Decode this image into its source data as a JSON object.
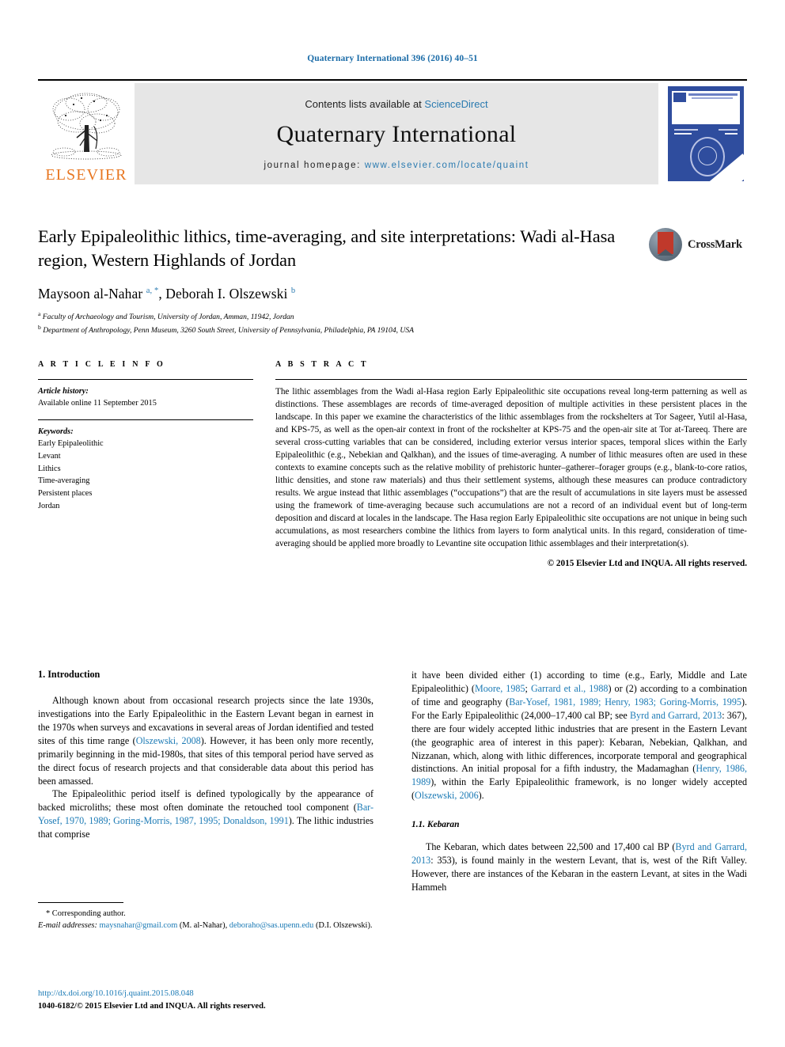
{
  "running_head": "Quaternary International 396 (2016) 40–51",
  "masthead": {
    "contents_prefix": "Contents lists available at ",
    "contents_link": "ScienceDirect",
    "journal_name": "Quaternary International",
    "homepage_label": "journal homepage:",
    "homepage_url": "www.elsevier.com/locate/quaint",
    "publisher": "ELSEVIER"
  },
  "article": {
    "title": "Early Epipaleolithic lithics, time-averaging, and site interpretations: Wadi al-Hasa region, Western Highlands of Jordan",
    "authors_html": "Maysoon al-Nahar <sup>a, *</sup>, Deborah I. Olszewski <sup>b</sup>",
    "affiliation_a": "Faculty of Archaeology and Tourism, University of Jordan, Amman, 11942, Jordan",
    "affiliation_b": "Department of Anthropology, Penn Museum, 3260 South Street, University of Pennsylvania, Philadelphia, PA 19104, USA",
    "crossmark_label": "CrossMark"
  },
  "info": {
    "heading": "A R T I C L E   I N F O",
    "history_label": "Article history:",
    "history_value": "Available online 11 September 2015",
    "keywords_label": "Keywords:",
    "keywords": [
      "Early Epipaleolithic",
      "Levant",
      "Lithics",
      "Time-averaging",
      "Persistent places",
      "Jordan"
    ]
  },
  "abstract": {
    "heading": "A B S T R A C T",
    "text": "The lithic assemblages from the Wadi al-Hasa region Early Epipaleolithic site occupations reveal long-term patterning as well as distinctions. These assemblages are records of time-averaged deposition of multiple activities in these persistent places in the landscape. In this paper we examine the characteristics of the lithic assemblages from the rockshelters at Tor Sageer, Yutil al-Hasa, and KPS-75, as well as the open-air context in front of the rockshelter at KPS-75 and the open-air site at Tor at-Tareeq. There are several cross-cutting variables that can be considered, including exterior versus interior spaces, temporal slices within the Early Epipaleolithic (e.g., Nebekian and Qalkhan), and the issues of time-averaging. A number of lithic measures often are used in these contexts to examine concepts such as the relative mobility of prehistoric hunter–gatherer–forager groups (e.g., blank-to-core ratios, lithic densities, and stone raw materials) and thus their settlement systems, although these measures can produce contradictory results. We argue instead that lithic assemblages (“occupations”) that are the result of accumulations in site layers must be assessed using the framework of time-averaging because such accumulations are not a record of an individual event but of long-term deposition and discard at locales in the landscape. The Hasa region Early Epipaleolithic site occupations are not unique in being such accumulations, as most researchers combine the lithics from layers to form analytical units. In this regard, consideration of time-averaging should be applied more broadly to Levantine site occupation lithic assemblages and their interpretation(s).",
    "copyright": "© 2015 Elsevier Ltd and INQUA. All rights reserved."
  },
  "body": {
    "section1_heading": "1. Introduction",
    "left_para1_html": "Although known about from occasional research projects since the late 1930s, investigations into the Early Epipaleolithic in the Eastern Levant began in earnest in the 1970s when surveys and excavations in several areas of Jordan identified and tested sites of this time range (<a class=\"cite\" href=\"#\">Olszewski, 2008</a>). However, it has been only more recently, primarily beginning in the mid-1980s, that sites of this temporal period have served as the direct focus of research projects and that considerable data about this period has been amassed.",
    "left_para2_html": "The Epipaleolithic period itself is defined typologically by the appearance of backed microliths; these most often dominate the retouched tool component (<a class=\"cite\" href=\"#\">Bar-Yosef, 1970, 1989; Goring-Morris, 1987, 1995; Donaldson, 1991</a>). The lithic industries that comprise",
    "right_para1_html": "it have been divided either (1) according to time (e.g., Early, Middle and Late Epipaleolithic) (<a class=\"cite\" href=\"#\">Moore, 1985</a>; <a class=\"cite\" href=\"#\">Garrard et al., 1988</a>) or (2) according to a combination of time and geography (<a class=\"cite\" href=\"#\">Bar-Yosef, 1981, 1989; Henry, 1983; Goring-Morris, 1995</a>). For the Early Epipaleolithic (24,000–17,400 cal BP; see <a class=\"cite\" href=\"#\">Byrd and Garrard, 2013</a>: 367), there are four widely accepted lithic industries that are present in the Eastern Levant (the geographic area of interest in this paper): Kebaran, Nebekian, Qalkhan, and Nizzanan, which, along with lithic differences, incorporate temporal and geographical distinctions. An initial proposal for a fifth industry, the Madamaghan (<a class=\"cite\" href=\"#\">Henry, 1986, 1989</a>), within the Early Epipaleolithic framework, is no longer widely accepted (<a class=\"cite\" href=\"#\">Olszewski, 2006</a>).",
    "subsection_heading": "1.1. Kebaran",
    "right_para2_html": "The Kebaran, which dates between 22,500 and 17,400 cal BP (<a class=\"cite\" href=\"#\">Byrd and Garrard, 2013</a>: 353), is found mainly in the western Levant, that is, west of the Rift Valley. However, there are instances of the Kebaran in the eastern Levant, at sites in the Wadi Hammeh"
  },
  "footnote": {
    "corresponding": "* Corresponding author.",
    "email_label": "E-mail addresses:",
    "email_1": "maysnahar@gmail.com",
    "email_1_owner": "(M. al-Nahar),",
    "email_2": "deborahо@sas.upenn.edu",
    "email_2_owner": "(D.I. Olszewski)."
  },
  "doi": {
    "url": "http://dx.doi.org/10.1016/j.quaint.2015.08.048",
    "issn_line": "1040-6182/© 2015 Elsevier Ltd and INQUA. All rights reserved."
  }
}
